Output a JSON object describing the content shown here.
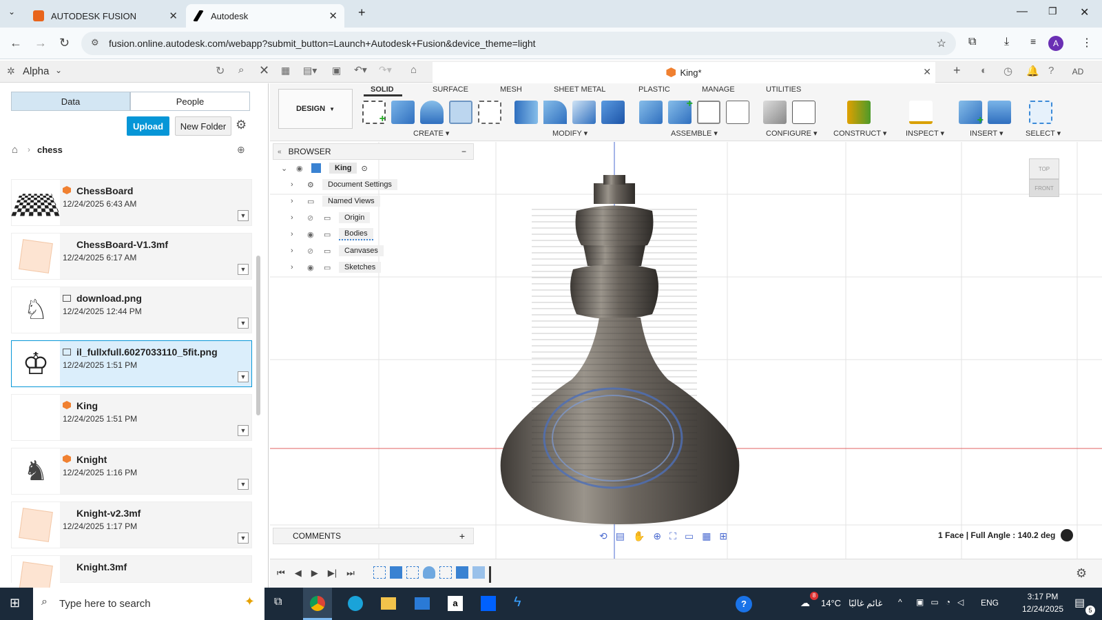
{
  "browser": {
    "tabs": [
      {
        "title": "AUTODESK FUSION",
        "active": false
      },
      {
        "title": "Autodesk",
        "active": true
      }
    ],
    "url": "fusion.online.autodesk.com/webapp?submit_button=Launch+Autodesk+Fusion&device_theme=light",
    "profile_initial": "A"
  },
  "app": {
    "team": "Alpha",
    "document_tab": "King*",
    "user_initials": "AD"
  },
  "data_panel": {
    "tabs": [
      "Data",
      "People"
    ],
    "upload_label": "Upload",
    "new_folder_label": "New Folder",
    "breadcrumb": "chess",
    "files": [
      {
        "name": "ChessBoard",
        "date": "12/24/2025 6:43 AM",
        "type": "design",
        "thumb": "board",
        "selected": false
      },
      {
        "name": "ChessBoard-V1.3mf",
        "date": "12/24/2025 6:17 AM",
        "type": "file",
        "thumb": "box",
        "selected": false
      },
      {
        "name": "download.png",
        "date": "12/24/2025 12:44 PM",
        "type": "image",
        "thumb": "knight-outline",
        "selected": false
      },
      {
        "name": "il_fullxfull.6027033110_5fit.png",
        "date": "12/24/2025 1:51 PM",
        "type": "image",
        "thumb": "king-outline",
        "selected": true
      },
      {
        "name": "King",
        "date": "12/24/2025 1:51 PM",
        "type": "design",
        "thumb": "blank",
        "selected": false
      },
      {
        "name": "Knight",
        "date": "12/24/2025 1:16 PM",
        "type": "design",
        "thumb": "knight-solid",
        "selected": false
      },
      {
        "name": "Knight-v2.3mf",
        "date": "12/24/2025 1:17 PM",
        "type": "file",
        "thumb": "box",
        "selected": false
      },
      {
        "name": "Knight.3mf",
        "date": "",
        "type": "file",
        "thumb": "box",
        "selected": false
      }
    ]
  },
  "toolbar": {
    "workspace": "DESIGN",
    "tabs": [
      "SOLID",
      "SURFACE",
      "MESH",
      "SHEET METAL",
      "PLASTIC",
      "MANAGE",
      "UTILITIES"
    ],
    "groups": [
      "CREATE",
      "MODIFY",
      "ASSEMBLE",
      "CONFIGURE",
      "CONSTRUCT",
      "INSPECT",
      "INSERT",
      "SELECT"
    ]
  },
  "browser_tree": {
    "title": "BROWSER",
    "root": "King",
    "items": [
      "Document Settings",
      "Named Views",
      "Origin",
      "Bodies",
      "Canvases",
      "Sketches"
    ]
  },
  "viewcube": {
    "top": "TOP",
    "front": "FRONT"
  },
  "comments_label": "COMMENTS",
  "status_text": "1 Face | Full Angle : 140.2 deg",
  "taskbar": {
    "search_placeholder": "Type here to search",
    "weather": "14°C",
    "weather_text": "غائم غالبًا",
    "lang": "ENG",
    "time": "3:17 PM",
    "date": "12/24/2025",
    "notif_count": "5",
    "weather_badge": "8"
  },
  "colors": {
    "accent": "#0696d7",
    "axis_red": "#e06060",
    "axis_blue": "#4a6ad0"
  }
}
